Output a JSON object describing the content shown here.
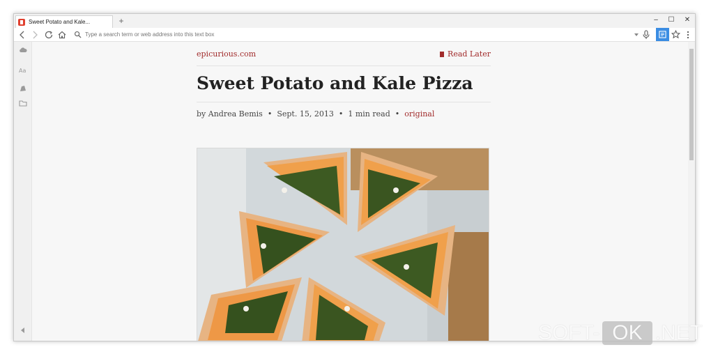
{
  "browser": {
    "tab_title": "Sweet Potato and Kale...",
    "new_tab_label": "+",
    "address_placeholder": "Type a search term or web address into this text box",
    "minimize_label": "–",
    "maximize_label": "☐",
    "close_label": "✕",
    "accent_color": "#3b8de3"
  },
  "article": {
    "site": "epicurious.com",
    "read_later": "Read Later",
    "title": "Sweet Potato and Kale Pizza",
    "author": "by Andrea Bemis",
    "date": "Sept. 15, 2013",
    "read_time": "1 min read",
    "original_link": "original",
    "separator": "•",
    "link_color": "#a12b2b"
  },
  "watermark": {
    "left": "SOFT-",
    "middle": "OK",
    "right": ".NET"
  }
}
